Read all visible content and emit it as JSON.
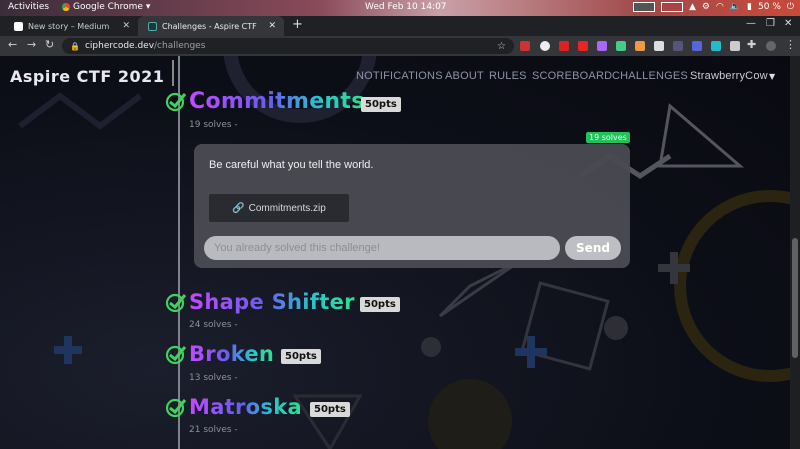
{
  "os_bar": {
    "activities": "Activities",
    "app_name": "Google Chrome",
    "clock": "Wed Feb 10  14:07",
    "battery": "50 %"
  },
  "browser": {
    "tabs": [
      {
        "title": "New story – Medium"
      },
      {
        "title": "Challenges - Aspire CTF"
      }
    ],
    "url_host": "ciphercode.dev",
    "url_path": "/challenges"
  },
  "site": {
    "brand": "Aspire CTF 2021",
    "nav": [
      "NOTIFICATIONS",
      "ABOUT",
      "RULES",
      "SCOREBOARD",
      "CHALLENGES"
    ],
    "user": "StrawberryCow"
  },
  "challenges": [
    {
      "name": "Commitments",
      "points": "50pts",
      "solves": "19 solves -",
      "solved": true
    },
    {
      "name": "Shape Shifter",
      "points": "50pts",
      "solves": "24 solves -",
      "solved": true
    },
    {
      "name": "Broken",
      "points": "50pts",
      "solves": "13 solves -",
      "solved": true
    },
    {
      "name": "Matroska",
      "points": "50pts",
      "solves": "21 solves -",
      "solved": true
    }
  ],
  "open_challenge": {
    "solve_badge": "19 solves",
    "description": "Be careful what you tell the world.",
    "file": "Commitments.zip",
    "flag_placeholder": "You already solved this challenge!",
    "submit_label": "Send"
  },
  "colors": {
    "check": "#3ed35c",
    "badge": "#21c25a",
    "title_gradient": [
      "#c24bff",
      "#6a5cf0",
      "#28c6c9",
      "#32e08a"
    ]
  }
}
